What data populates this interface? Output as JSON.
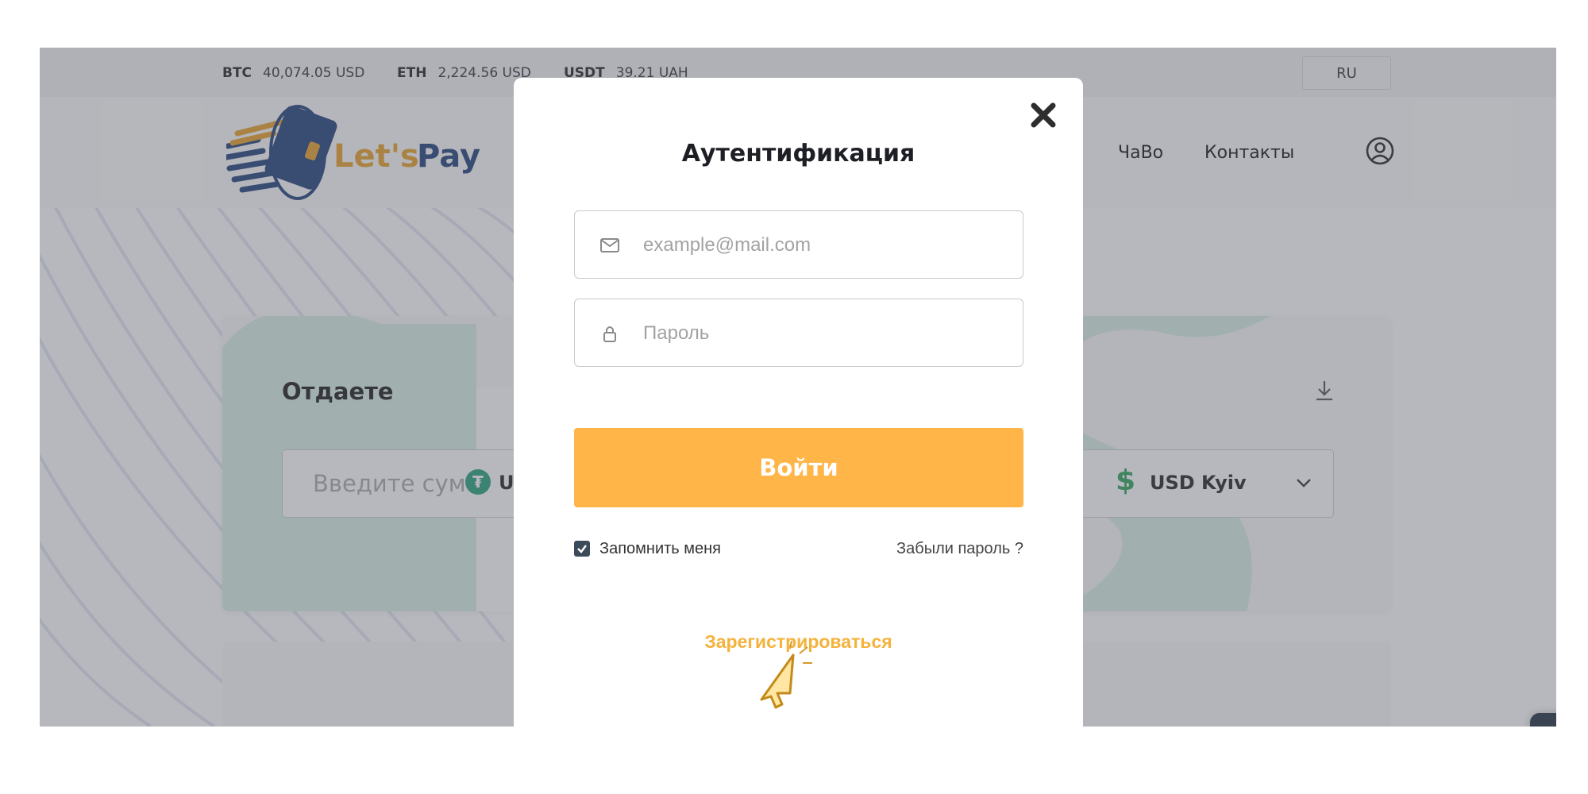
{
  "ticker": {
    "items": [
      {
        "symbol": "BTC",
        "value": "40,074.05 USD"
      },
      {
        "symbol": "ETH",
        "value": "2,224.56 USD"
      },
      {
        "symbol": "USDT",
        "value": "39.21 UAH"
      }
    ],
    "language": "RU"
  },
  "header": {
    "logo_part1": "Let's",
    "logo_part2": "Pay",
    "nav": [
      "ЧаВо",
      "Контакты"
    ]
  },
  "exchange": {
    "give_label": "Отдаете",
    "give_placeholder": "Введите сум",
    "give_currency": "U",
    "get_currency": "USD Kyiv"
  },
  "modal": {
    "title": "Аутентификация",
    "email_placeholder": "example@mail.com",
    "password_placeholder": "Пароль",
    "login_label": "Войти",
    "remember_label": "Запомнить меня",
    "remember_checked": true,
    "forgot_label": "Забыли пароль ?",
    "register_label": "Зарегистрироваться"
  },
  "colors": {
    "accent": "#ffb547",
    "register_link": "#f5b23c",
    "logo_orange": "#e8a128",
    "logo_blue": "#1f3f7a",
    "tether": "#26a17b",
    "dollar": "#2ea35a",
    "chat_button": "#3a4351"
  },
  "icons": {
    "email": "envelope-icon",
    "password": "lock-icon",
    "close": "close-icon",
    "account": "user-circle-icon",
    "download": "download-icon",
    "chat": "chat-bubble-icon"
  }
}
